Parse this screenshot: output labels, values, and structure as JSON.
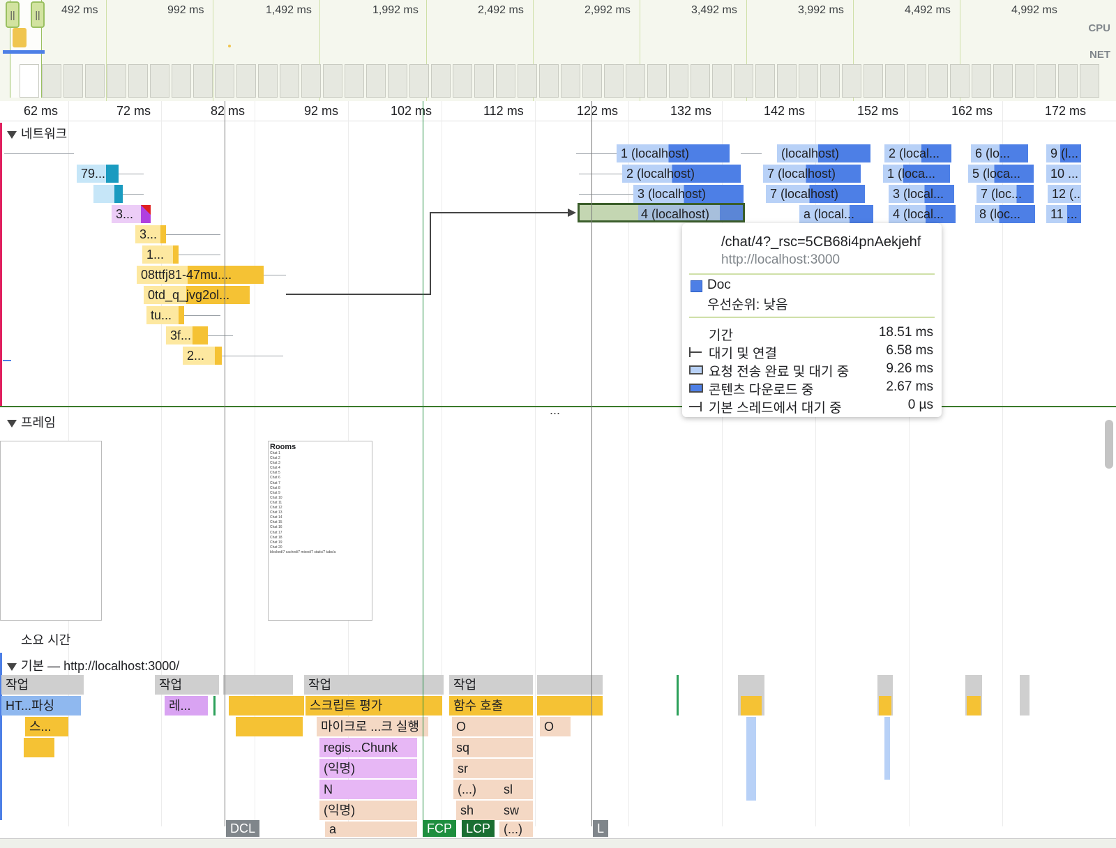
{
  "overview": {
    "ticks": [
      "492 ms",
      "992 ms",
      "1,492 ms",
      "1,992 ms",
      "2,492 ms",
      "2,992 ms",
      "3,492 ms",
      "3,992 ms",
      "4,492 ms",
      "4,992 ms"
    ],
    "cpu_label": "CPU",
    "net_label": "NET",
    "handle_glyph": "||"
  },
  "ruler": {
    "ticks": [
      "62 ms",
      "72 ms",
      "82 ms",
      "92 ms",
      "102 ms",
      "112 ms",
      "122 ms",
      "132 ms",
      "142 ms",
      "152 ms",
      "162 ms",
      "172 ms"
    ]
  },
  "network": {
    "title": "네트워크",
    "left_requests": [
      "79...",
      "3...",
      "3...",
      "1...",
      "08ttfj81-47mu....",
      "0td_q_jvg2ol...",
      "tu...",
      "3f...",
      "2..."
    ],
    "right_requests": {
      "col1": [
        "1 (localhost)",
        "2 (localhost)",
        "3 (localhost)",
        "4 (localhost)"
      ],
      "col2": [
        "(localhost)",
        "7 (localhost)",
        "7 (localhost)",
        "a (local..."
      ],
      "col3": [
        "2 (local...",
        "1 (loca...",
        "3 (local...",
        "4 (local..."
      ],
      "col4": [
        "6 (lo...",
        "5 (loca...",
        "7 (loc...",
        "8 (loc..."
      ],
      "col5": [
        "9 (l...",
        "10 ...",
        "12 (...",
        "11 ..."
      ]
    },
    "divider_dots": "..."
  },
  "tooltip": {
    "url": "/chat/4?_rsc=5CB68i4pnAekjehf",
    "host": "http://localhost:3000",
    "type": "Doc",
    "priority": "우선순위: 낮음",
    "duration_label": "기간",
    "duration_value": "18.51 ms",
    "rows": [
      {
        "label": "대기 및 연결",
        "value": "6.58 ms"
      },
      {
        "label": "요청 전송 완료 및 대기 중",
        "value": "9.26 ms"
      },
      {
        "label": "콘텐츠 다운로드 중",
        "value": "2.67 ms"
      },
      {
        "label": "기본 스레드에서 대기 중",
        "value": "0 µs"
      }
    ]
  },
  "frames": {
    "title": "프레임",
    "preview_title": "Rooms",
    "preview_items": [
      "Chat 1",
      "Chat 2",
      "Chat 3",
      "Chat 4",
      "Chat 5",
      "Chat 6",
      "Chat 7",
      "Chat 8",
      "Chat 9",
      "Chat 10",
      "Chat 11",
      "Chat 12",
      "Chat 13",
      "Chat 14",
      "Chat 15",
      "Chat 16",
      "Chat 17",
      "Chat 18",
      "Chat 19",
      "Chat 20",
      "blocked/7 cached/7 mixed/7 static/7 tabs/a"
    ]
  },
  "timings_title": "소요 시간",
  "main": {
    "title": "기본 — http://localhost:3000/",
    "task_label": "작업",
    "flame": {
      "parse_html": "HT...파싱",
      "re": "레...",
      "script_eval": "스크립트 평가",
      "func_call": "함수 호출",
      "s_short": "스...",
      "microtask": "마이크로 ...크 실행",
      "o1": "O",
      "o2": "O",
      "regis": "regis...Chunk",
      "sq": "sq",
      "anon1": "(익명)",
      "sr": "sr",
      "n": "N",
      "paren": "(...)",
      "sl": "sl",
      "anon2": "(익명)",
      "sh": "sh",
      "sw": "sw",
      "a": "a",
      "paren2": "(...)"
    },
    "markers": {
      "dcl": "DCL",
      "fcp": "FCP",
      "lcp": "LCP",
      "l": "L"
    }
  },
  "colors": {
    "doc_blue": "#4d7fe6",
    "light_blue": "#b8d1f7",
    "script_yellow": "#f5c234",
    "pale_yellow": "#fde8a0",
    "purple": "#d9a3f2",
    "task_gray": "#cfcfcf",
    "peach": "#f4d8c4",
    "fcp_green": "#1e8e3e"
  }
}
